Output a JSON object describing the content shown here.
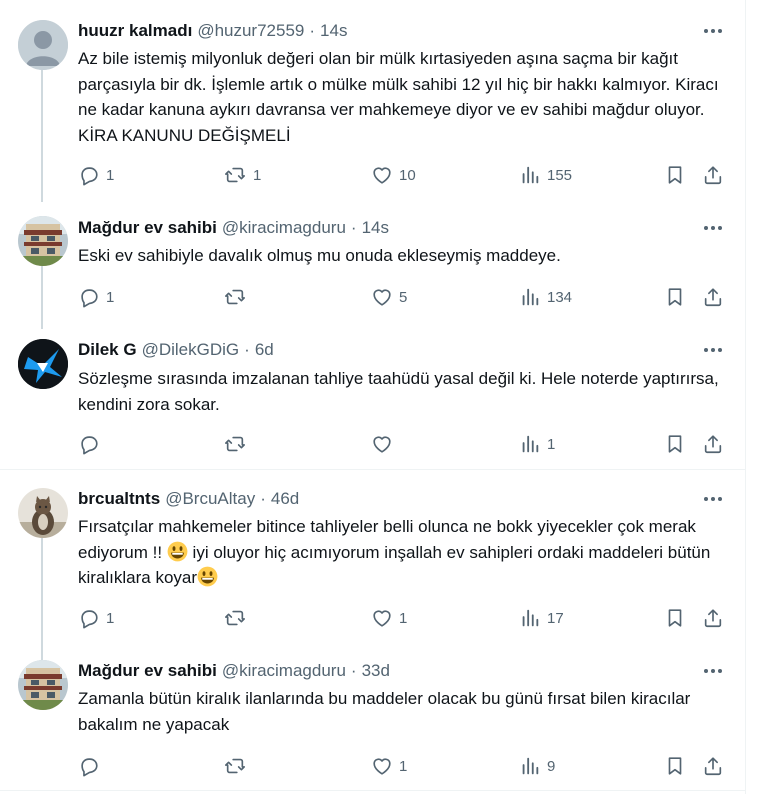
{
  "tweets": [
    {
      "name": "huuzr kalmadı",
      "handle": "@huzur72559",
      "time": "14s",
      "text": "Az bile istemiş milyonluk değeri olan bir mülk kırtasiyeden aşına saçma bir kağıt parçasıyla bir dk. İşlemle artık o mülke mülk sahibi 12 yıl hiç bir hakkı kalmıyor. Kiracı ne kadar kanuna aykırı davransa ver mahkemeye diyor ve ev sahibi mağdur oluyor. KİRA KANUNU DEĞİŞMELİ",
      "replies": "1",
      "retweets": "1",
      "likes": "10",
      "views": "155"
    },
    {
      "name": "Mağdur ev sahibi",
      "handle": "@kiracimagduru",
      "time": "14s",
      "text": "Eski ev sahibiyle davalık olmuş mu onuda eklesеymiş maddeye.",
      "replies": "1",
      "retweets": "",
      "likes": "5",
      "views": "134"
    },
    {
      "name": "Dilek G",
      "handle": "@DilekGDiG",
      "time": "6d",
      "text": "Sözleşme sırasında imzalanan tahliye taahüdü yasal değil ki. Hele noterde yaptırırsa, kendini zora sokar.",
      "replies": "",
      "retweets": "",
      "likes": "",
      "views": "1"
    },
    {
      "name": "brcualtnts",
      "handle": "@BrcuAltay",
      "time": "46d",
      "text_parts": [
        "Fırsatçılar mahkemeler bitince tahliyeler belli olunca ne bokk yiyecekler çok merak ediyorum !! ",
        " iyi oluyor hiç acımıyorum inşallah ev sahipleri ordaki maddeleri bütün kiralıklara koyar"
      ],
      "emoji": "grinning-face",
      "replies": "1",
      "retweets": "",
      "likes": "1",
      "views": "17"
    },
    {
      "name": "Mağdur ev sahibi",
      "handle": "@kiracimagduru",
      "time": "33d",
      "text": "Zamanla bütün kiralık ilanlarında bu maddeler olacak bu günü fırsat bilen kiracılar bakalım ne yapacak",
      "replies": "",
      "retweets": "",
      "likes": "1",
      "views": "9"
    }
  ],
  "separator": "·",
  "colors": {
    "text": "#0f1419",
    "muted": "#536471",
    "thread_line": "#cfd9de",
    "divider": "#eff3f4",
    "emoji": "#ffcc4d"
  },
  "icons": [
    "default-avatar-icon",
    "more-icon",
    "reply-icon",
    "retweet-icon",
    "like-icon",
    "views-icon",
    "bookmark-icon",
    "share-icon"
  ]
}
